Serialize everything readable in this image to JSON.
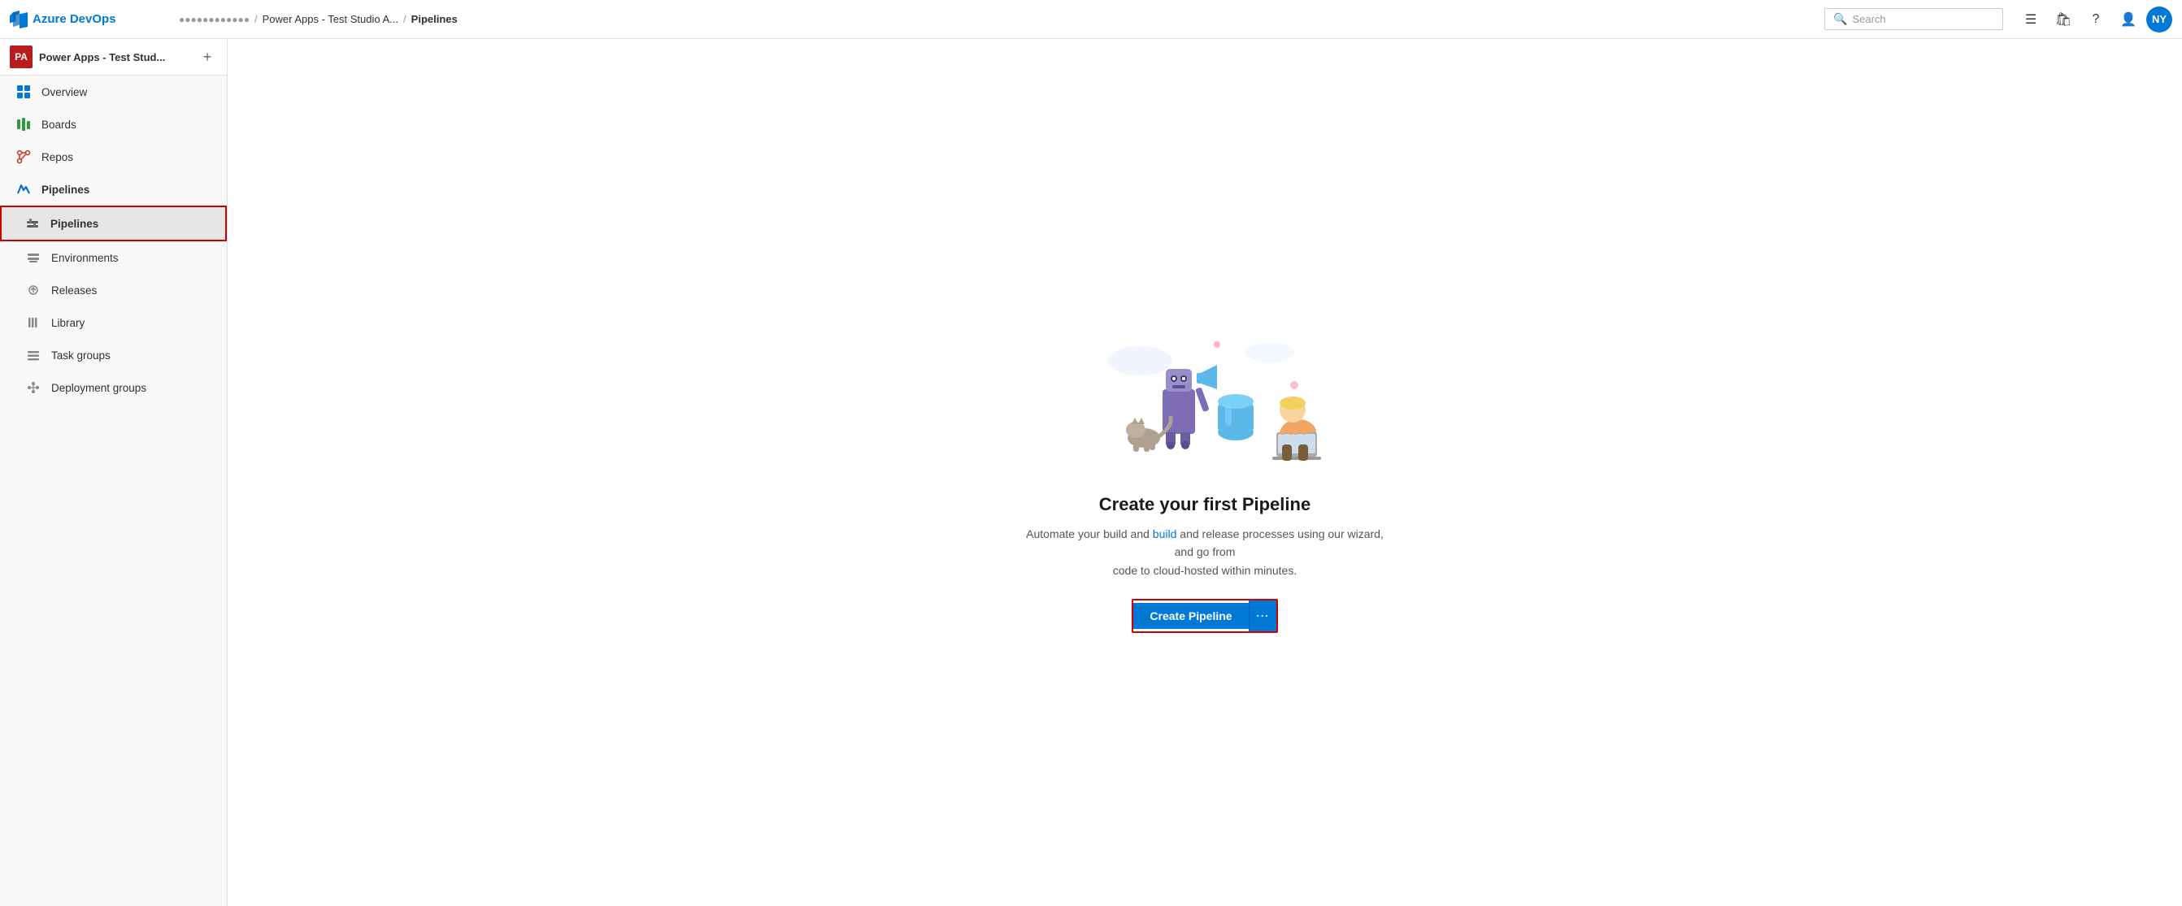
{
  "brand": {
    "logo_label": "Azure DevOps",
    "title": "Azure DevOps"
  },
  "topbar": {
    "org": "●●●●●●●●●●●●",
    "sep1": "/",
    "project": "Power Apps - Test Studio A...",
    "sep2": "/",
    "page": "Pipelines",
    "search_placeholder": "Search",
    "search_label": "Search",
    "avatar_label": "NY"
  },
  "sidebar": {
    "project_icon": "PA",
    "project_name": "Power Apps - Test Stud...",
    "add_label": "+",
    "nav_items": [
      {
        "id": "overview",
        "label": "Overview",
        "icon": "overview"
      },
      {
        "id": "boards",
        "label": "Boards",
        "icon": "boards"
      },
      {
        "id": "repos",
        "label": "Repos",
        "icon": "repos"
      },
      {
        "id": "pipelines-parent",
        "label": "Pipelines",
        "icon": "pipelines"
      },
      {
        "id": "pipelines",
        "label": "Pipelines",
        "icon": "pipelines-sub",
        "active": true
      },
      {
        "id": "environments",
        "label": "Environments",
        "icon": "environments"
      },
      {
        "id": "releases",
        "label": "Releases",
        "icon": "releases"
      },
      {
        "id": "library",
        "label": "Library",
        "icon": "library"
      },
      {
        "id": "task-groups",
        "label": "Task groups",
        "icon": "task-groups"
      },
      {
        "id": "deployment-groups",
        "label": "Deployment groups",
        "icon": "deployment-groups"
      }
    ]
  },
  "main": {
    "empty_state": {
      "title": "Create your first Pipeline",
      "description_part1": "Automate your build and ",
      "description_link1": "build",
      "description_part2": " and release processes using our wizard, and go from",
      "description_part3": "code to cloud-hosted within minutes.",
      "description_full": "Automate your build and release processes using our wizard, and go from code to cloud-hosted within minutes.",
      "create_button_label": "Create Pipeline",
      "more_button_label": "⋯"
    }
  }
}
